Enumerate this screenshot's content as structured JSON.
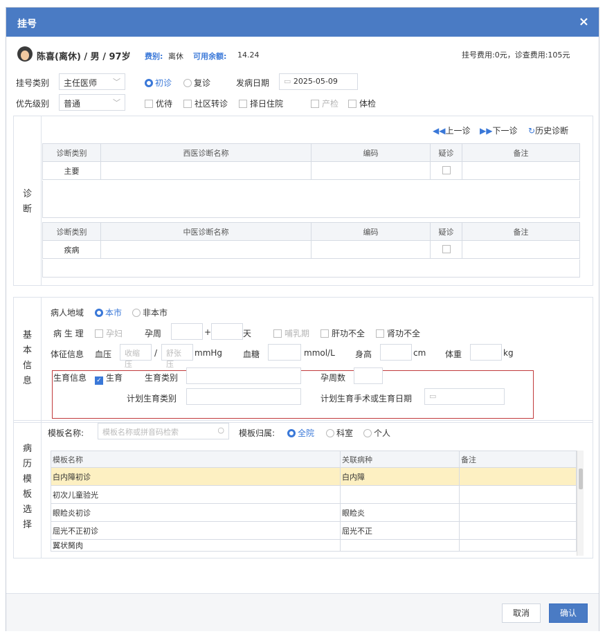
{
  "dialog": {
    "title": "挂号",
    "close": "×"
  },
  "patient": {
    "name_line": "陈喜(离休) / 男 / 97岁",
    "fee_type_label": "费别:",
    "fee_type_value": "离休",
    "balance_label": "可用余额:",
    "balance_value": "14.24",
    "fees_summary": "挂号费用:0元，诊查费用:105元"
  },
  "reg": {
    "type_label": "挂号类别",
    "type_value": "主任医师",
    "first_visit": "初诊",
    "return_visit": "复诊",
    "onset_label": "发病日期",
    "onset_value": "2025-05-09",
    "priority_label": "优先级别",
    "priority_value": "普通",
    "opt_priority": "优待",
    "opt_community": "社区转诊",
    "opt_hospitalize": "择日住院",
    "opt_prenatal": "产检",
    "opt_physical": "体检"
  },
  "diagnosis": {
    "side": "诊断",
    "prev": "上一诊",
    "next": "下一诊",
    "history": "历史诊断",
    "western_headers": [
      "诊断类别",
      "西医诊断名称",
      "编码",
      "疑诊",
      "备注"
    ],
    "western_row": {
      "category": "主要"
    },
    "chinese_headers": [
      "诊断类别",
      "中医诊断名称",
      "编码",
      "疑诊",
      "备注"
    ],
    "chinese_row": {
      "category": "疾病"
    }
  },
  "basic": {
    "side": "基本信息",
    "region_label": "病人地域",
    "region_local": "本市",
    "region_other": "非本市",
    "physio_label": "病 生 理",
    "pregnant": "孕妇",
    "gest_week_label": "孕周",
    "plus": "+",
    "day": "天",
    "lactation": "哺乳期",
    "liver": "肝功不全",
    "kidney": "肾功不全",
    "vitals_label": "体征信息",
    "bp_label": "血压",
    "bp_sys_ph": "收缩压",
    "bp_slash": "/",
    "bp_dia_ph": "舒张压",
    "bp_unit": "mmHg",
    "glucose_label": "血糖",
    "glucose_unit": "mmol/L",
    "height_label": "身高",
    "height_unit": "cm",
    "weight_label": "体重",
    "weight_unit": "kg",
    "fertility_label": "生育信息",
    "fertility_check": "生育",
    "fertility_type_label": "生育类别",
    "pregnancy_count_label": "孕周数",
    "plan_type_label": "计划生育类别",
    "plan_date_label": "计划生育手术或生育日期"
  },
  "template": {
    "side": "病历模板选择",
    "name_label": "模板名称:",
    "search_ph": "模板名称或拼音码检索",
    "owner_label": "模板归属:",
    "owner_all": "全院",
    "owner_dept": "科室",
    "owner_person": "个人",
    "headers": [
      "模板名称",
      "关联病种",
      "备注"
    ],
    "rows": [
      {
        "name": "白内障初诊",
        "disease": "白内障",
        "note": ""
      },
      {
        "name": "初次儿童验光",
        "disease": "",
        "note": ""
      },
      {
        "name": "眼睑炎初诊",
        "disease": "眼睑炎",
        "note": ""
      },
      {
        "name": "屈光不正初诊",
        "disease": "屈光不正",
        "note": ""
      },
      {
        "name": "翼状胬肉",
        "disease": "",
        "note": ""
      }
    ]
  },
  "footer": {
    "cancel": "取消",
    "ok": "确认"
  }
}
